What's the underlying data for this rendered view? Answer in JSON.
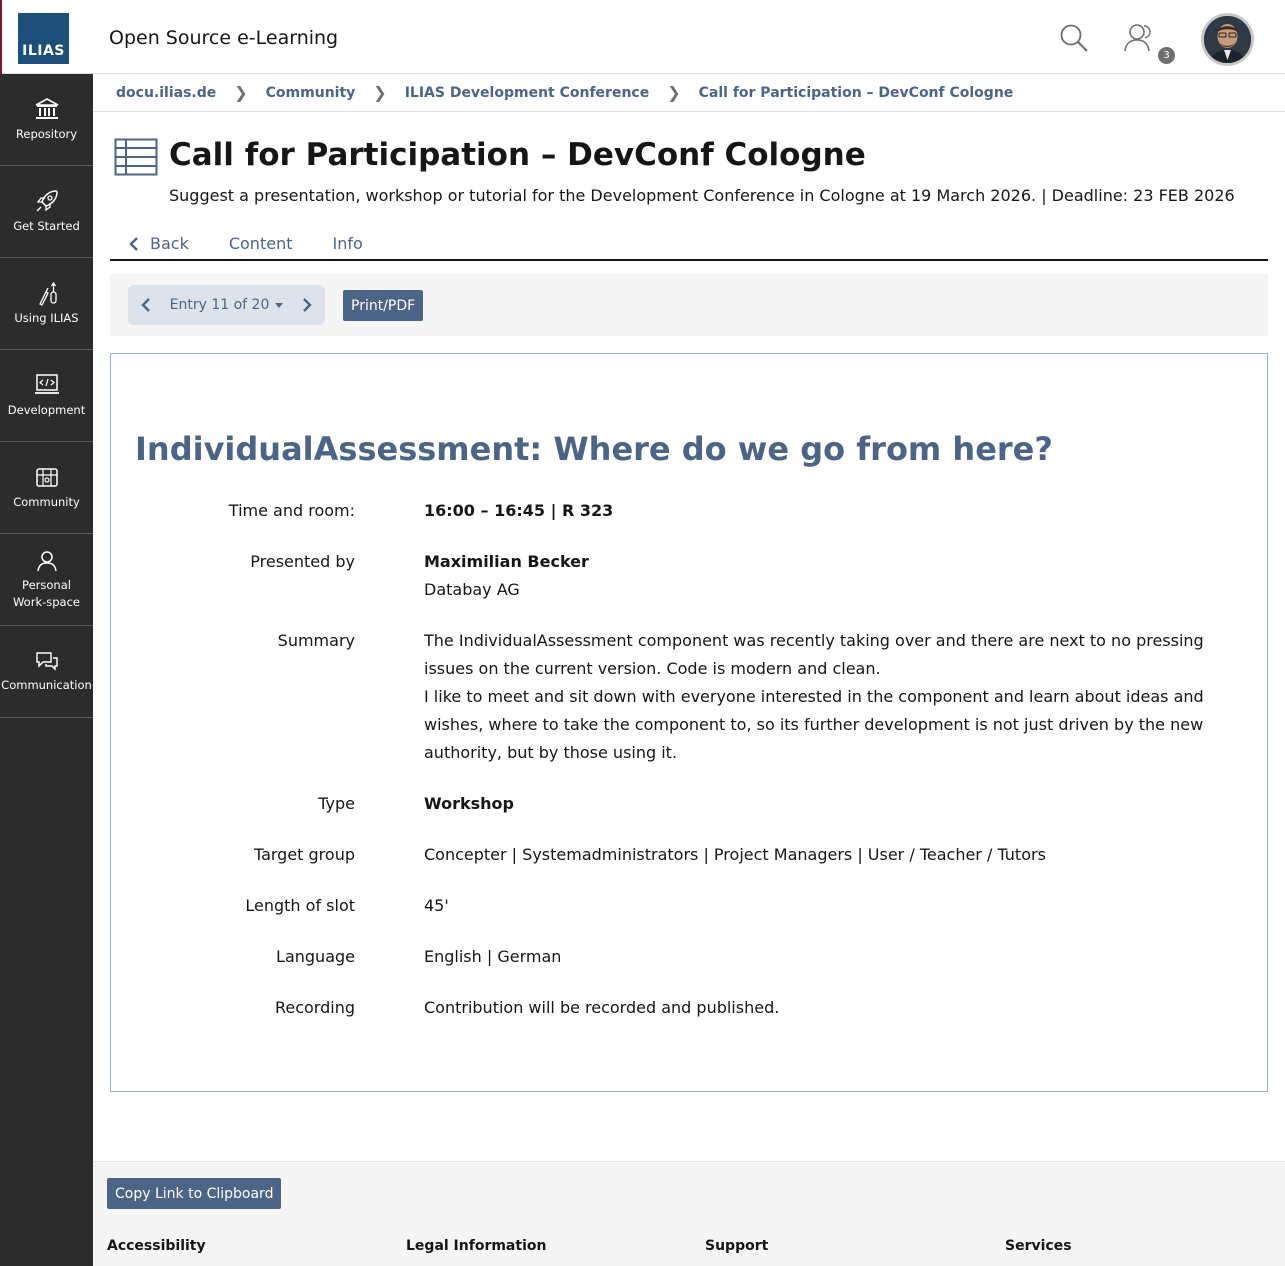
{
  "header": {
    "logo_text": "ILIAS",
    "site_title": "Open Source e-Learning",
    "notification_count": "3",
    "colors": {
      "brand": "#1e4f79",
      "accent": "#4c6586",
      "sidebar": "#2c2c2c"
    }
  },
  "sidebar": {
    "items": [
      {
        "label": "Repository",
        "icon": "bank-icon"
      },
      {
        "label": "Get Started",
        "icon": "rocket-icon"
      },
      {
        "label": "Using ILIAS",
        "icon": "tools-icon"
      },
      {
        "label": "Development",
        "icon": "code-laptop-icon"
      },
      {
        "label": "Community",
        "icon": "map-icon"
      },
      {
        "label": "Personal Work-space",
        "icon": "person-icon"
      },
      {
        "label": "Communication",
        "icon": "chat-icon"
      }
    ]
  },
  "breadcrumb": [
    "docu.ilias.de",
    "Community",
    "ILIAS Development Conference",
    "Call for Participation – DevConf Cologne"
  ],
  "page": {
    "title": "Call for Participation – DevConf Cologne",
    "description": "Suggest a presentation, workshop or tutorial for the Development Conference in Cologne at 19 March 2026. | Deadline: 23 FEB 2026",
    "tabs": {
      "back": "Back",
      "content": "Content",
      "info": "Info"
    }
  },
  "toolbar": {
    "entry_label": "Entry 11 of 20",
    "print_label": "Print/PDF"
  },
  "entry": {
    "title": "IndividualAssessment: Where do we go from here?",
    "fields": {
      "time": {
        "label": "Time and room:",
        "value": "16:00 – 16:45 | R 323"
      },
      "presenter": {
        "label": "Presented by",
        "name": "Maximilian Becker",
        "org": "Databay AG"
      },
      "summary": {
        "label": "Summary",
        "p1": "The IndividualAssessment component was recently taking over and there are next to no pressing issues on the current version. Code is modern and clean.",
        "p2": "I like to meet and sit down with everyone interested in the component and learn about ideas and wishes, where to take the component to, so its further development is not just driven by the new authority, but by those using it."
      },
      "type": {
        "label": "Type",
        "value": "Workshop"
      },
      "target": {
        "label": "Target group",
        "value": "Concepter | Systemadministrators | Project Managers | User / Teacher / Tutors"
      },
      "length": {
        "label": "Length of slot",
        "value": "45'"
      },
      "language": {
        "label": "Language",
        "value": "English | German"
      },
      "recording": {
        "label": "Recording",
        "value": "Contribution will be recorded and published."
      }
    }
  },
  "footer": {
    "copy_label": "Copy Link to Clipboard",
    "links": [
      "Accessibility",
      "Legal Information",
      "Support",
      "Services"
    ]
  }
}
